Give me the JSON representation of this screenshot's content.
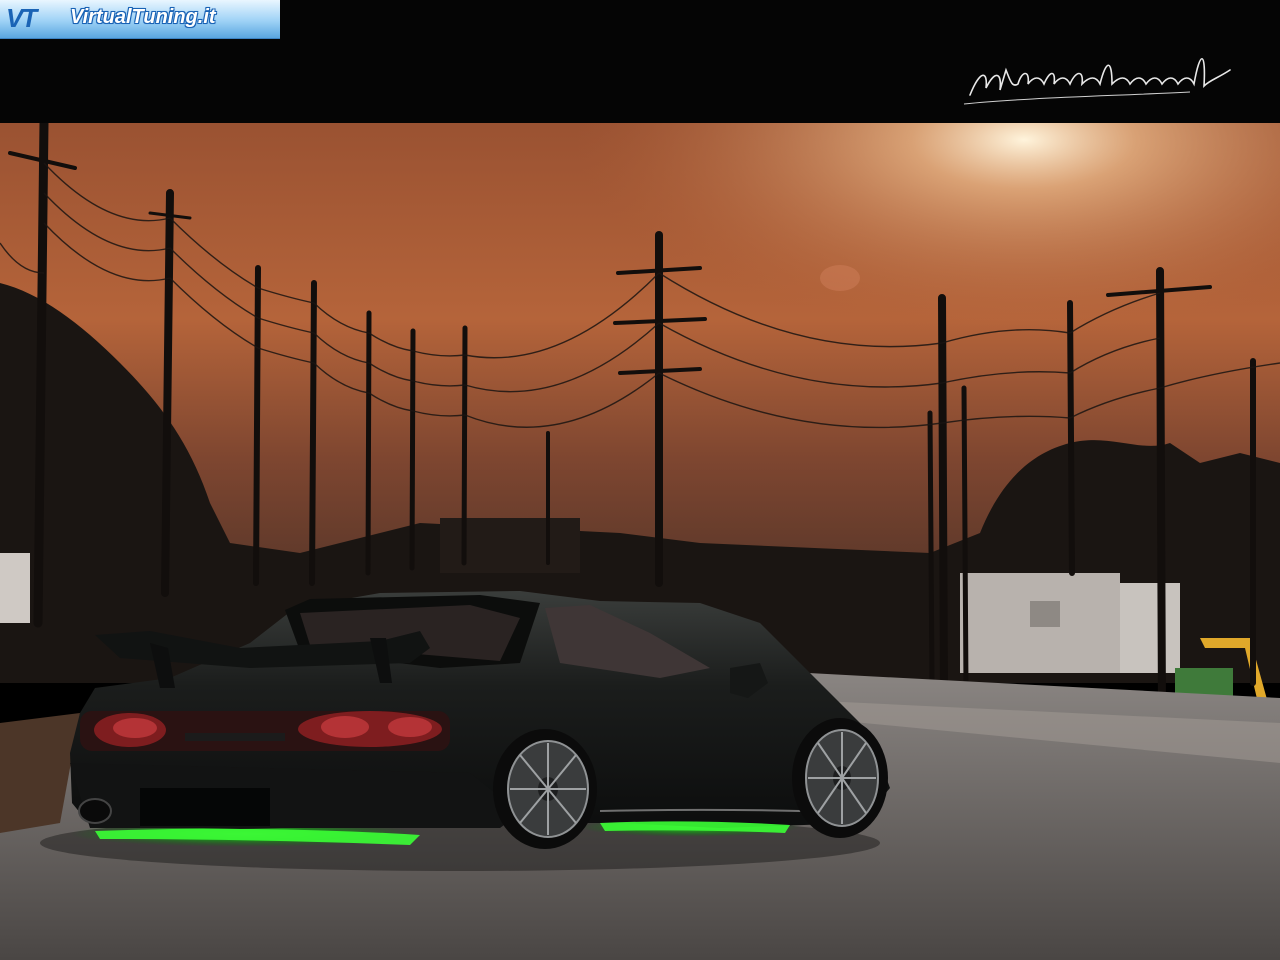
{
  "watermark": {
    "brand": "VirtualTuning.it",
    "signature": "physicalmind"
  },
  "icons": [
    "vt-logo-icon"
  ],
  "colors": {
    "sky_top": "#b5643a",
    "sky_glow": "#f0c9a0",
    "header": "#050505",
    "underglow": "#38ff3a",
    "road": "#6f6a66",
    "car_body": "#161817"
  }
}
